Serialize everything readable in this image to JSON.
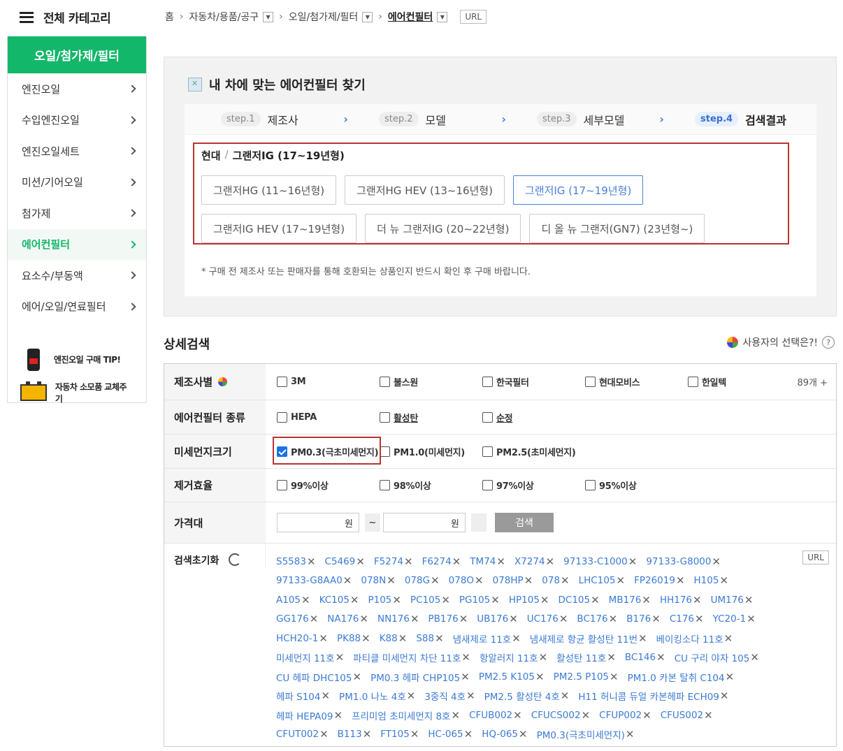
{
  "category_header": {
    "title": "전체 카테고리"
  },
  "sidebar": {
    "heading": "오일/첨가제/필터",
    "items": [
      {
        "label": "엔진오일"
      },
      {
        "label": "수입엔진오일"
      },
      {
        "label": "엔진오일세트"
      },
      {
        "label": "미션/기어오일"
      },
      {
        "label": "첨가제"
      },
      {
        "label": "에어컨필터"
      },
      {
        "label": "요소수/부동액"
      },
      {
        "label": "에어/오일/연료필터"
      }
    ],
    "active_index": 5,
    "promos": [
      {
        "label": "엔진오일 구매 TIP!",
        "icon": "oil-bottle-icon"
      },
      {
        "label": "자동차 소모품 교체주기",
        "icon": "battery-icon"
      }
    ]
  },
  "breadcrumb": {
    "home": "홈",
    "level1": "자동차/용품/공구",
    "level2": "오일/첨가제/필터",
    "current": "에어컨필터",
    "url_label": "URL"
  },
  "finder": {
    "title": "내 차에 맞는 에어컨필터 찾기",
    "steps": [
      {
        "pill": "step.1",
        "label": "제조사"
      },
      {
        "pill": "step.2",
        "label": "모델"
      },
      {
        "pill": "step.3",
        "label": "세부모델"
      },
      {
        "pill": "step.4",
        "label": "검색결과"
      }
    ],
    "path_maker": "현대",
    "path_sep": "/",
    "path_model": "그랜저IG (17~19년형)",
    "models": [
      "그랜저HG (11~16년형)",
      "그랜저HG HEV (13~16년형)",
      "그랜저IG (17~19년형)",
      "그랜저IG HEV (17~19년형)",
      "더 뉴 그랜저IG (20~22년형)",
      "디 올 뉴 그랜저(GN7) (23년형~)"
    ],
    "selected_model_index": 2,
    "notice": "* 구매 전 제조사 또는 판매자를 통해 호환되는 상품인지 반드시 확인 후 구매 바랍니다."
  },
  "detail": {
    "title": "상세검색",
    "help": "사용자의 선택은?!",
    "help_icon": "?",
    "maker_label": "제조사별",
    "makers": [
      "3M",
      "불스원",
      "한국필터",
      "현대모비스",
      "한일텍"
    ],
    "maker_count": "89개 +",
    "type_label": "에어컨필터 종류",
    "types": [
      "HEPA",
      "활성탄",
      "순정"
    ],
    "pm_label": "미세먼지크기",
    "pm": [
      "PM0.3(극초미세먼지)",
      "PM1.0(미세먼지)",
      "PM2.5(초미세먼지)"
    ],
    "pm_checked_index": 0,
    "eff_label": "제거효율",
    "eff": [
      "99%이상",
      "98%이상",
      "97%이상",
      "95%이상"
    ],
    "price_label": "가격대",
    "price_unit": "원",
    "price_tilde": "~",
    "search_btn": "검색",
    "reset_label": "검색초기화",
    "url_label": "URL",
    "tags": [
      "S5583",
      "C5469",
      "F5274",
      "F6274",
      "TM74",
      "X7274",
      "97133-C1000",
      "97133-G8000",
      "97133-G8AA0",
      "078N",
      "078G",
      "078O",
      "078HP",
      "078",
      "LHC105",
      "FP26019",
      "H105",
      "A105",
      "KC105",
      "P105",
      "PC105",
      "PG105",
      "HP105",
      "DC105",
      "MB176",
      "HH176",
      "UM176",
      "GG176",
      "NA176",
      "NN176",
      "PB176",
      "UB176",
      "UC176",
      "BC176",
      "B176",
      "C176",
      "YC20-1",
      "HCH20-1",
      "PK88",
      "K88",
      "S88",
      "냄새제로 11호",
      "냄새제로 항균 활성탄 11번",
      "베이킹소다 11호",
      "미세먼지 11호",
      "파티클 미세먼지 차단 11호",
      "항알러지 11호",
      "활성탄 11호",
      "BC146",
      "CU 구리 야자 105",
      "CU 헤파 DHC105",
      "PM0.3 헤파 CHP105",
      "PM2.5 K105",
      "PM2.5 P105",
      "PM1.0 카본 탈취 C104",
      "헤파 S104",
      "PM1.0 나노 4호",
      "3중직 4호",
      "PM2.5 활성탄 4호",
      "H11 허니콤 듀얼 카본헤파 ECH09",
      "헤파 HEPA09",
      "프리미엄 초미세먼지 8호",
      "CFUB002",
      "CFUCS002",
      "CFUP002",
      "CFUS002",
      "CFUT002",
      "B113",
      "FT105",
      "HC-065",
      "HQ-065",
      "PM0.3(극초미세먼지)"
    ],
    "tag_remove": "✕"
  }
}
